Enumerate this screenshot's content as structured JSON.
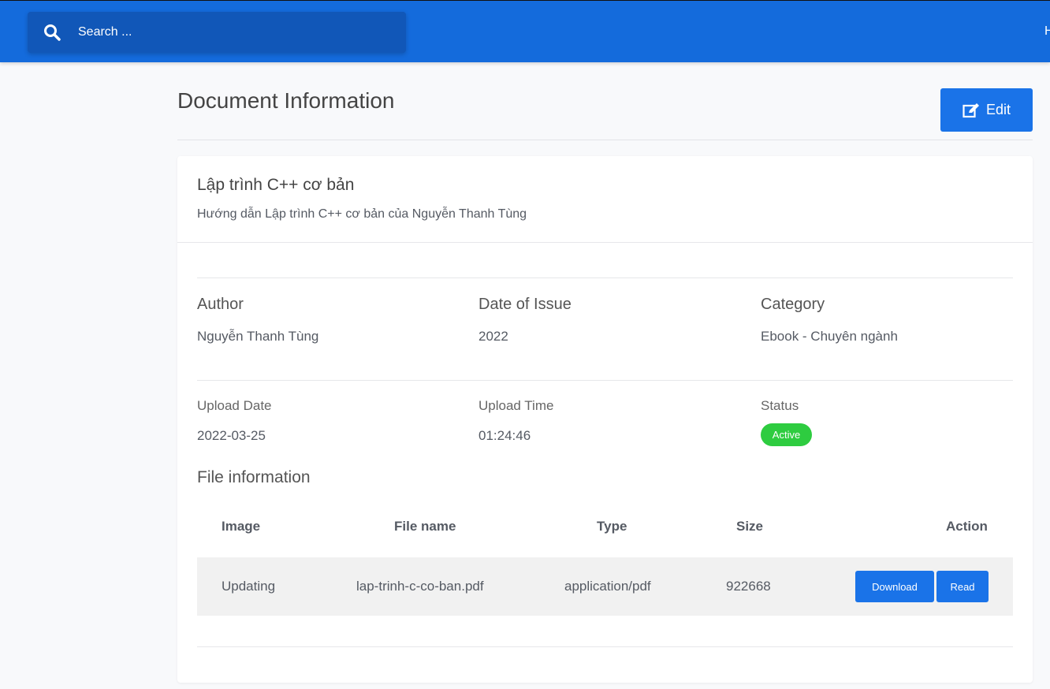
{
  "header": {
    "search_placeholder": "Search ...",
    "nav_partial": "H"
  },
  "page": {
    "title": "Document Information",
    "edit_label": "Edit"
  },
  "document": {
    "name": "Lập trình C++ cơ bản",
    "description": "Hướng dẫn Lập trình C++ cơ bản của Nguyễn Thanh Tùng",
    "author_label": "Author",
    "author": "Nguyễn Thanh Tùng",
    "date_label": "Date of Issue",
    "date": "2022",
    "category_label": "Category",
    "category": "Ebook - Chuyên ngành",
    "upload_date_label": "Upload Date",
    "upload_date": "2022-03-25",
    "upload_time_label": "Upload Time",
    "upload_time": "01:24:46",
    "status_label": "Status",
    "status": "Active",
    "status_color": "#2ecc40"
  },
  "files": {
    "title": "File information",
    "columns": [
      "Image",
      "File name",
      "Type",
      "Size",
      "Action"
    ],
    "rows": [
      {
        "image": "Updating",
        "file_name": "lap-trinh-c-co-ban.pdf",
        "type": "application/pdf",
        "size": "922668",
        "download": "Download",
        "read": "Read"
      }
    ]
  },
  "colors": {
    "primary": "#146bdc",
    "button": "#1a73e8"
  }
}
